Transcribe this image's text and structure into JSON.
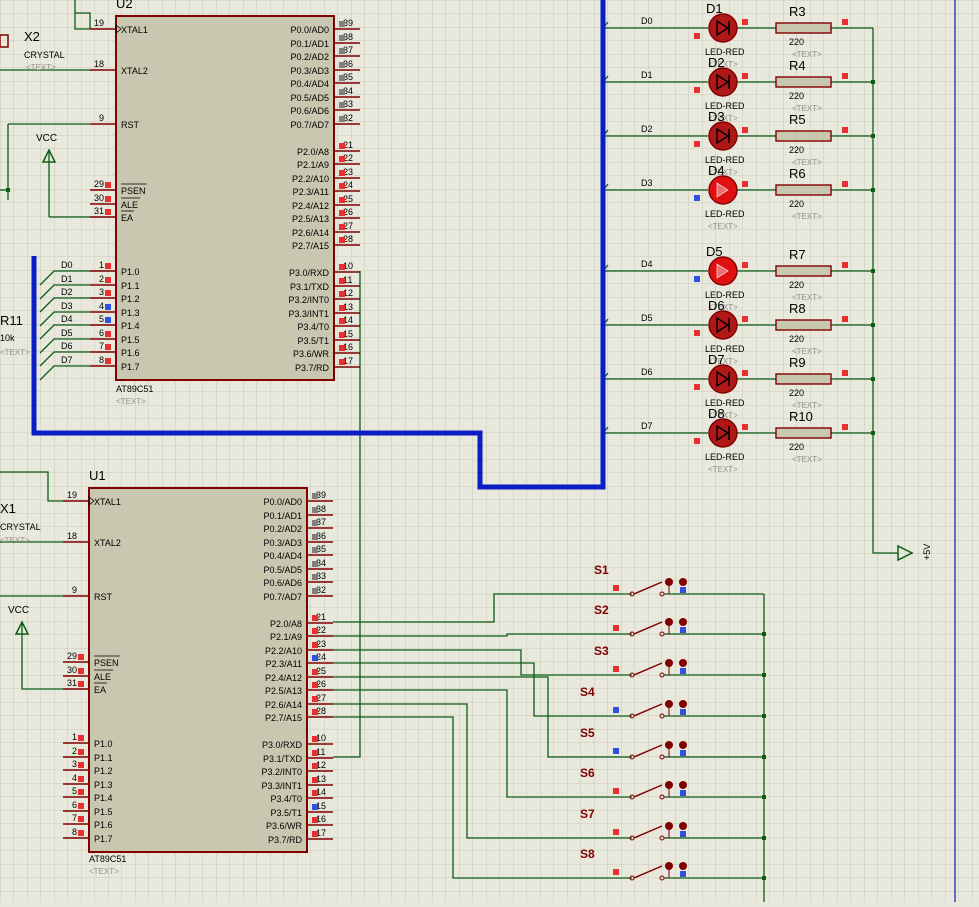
{
  "u2": {
    "ref": "U2",
    "part": "AT89C51",
    "text_tag": "<TEXT>",
    "left_pins": [
      {
        "num": "19",
        "name": "XTAL1"
      },
      {
        "num": "18",
        "name": "XTAL2"
      },
      {
        "num": "9",
        "name": "RST"
      },
      {
        "num": "29",
        "name": "PSEN"
      },
      {
        "num": "30",
        "name": "ALE"
      },
      {
        "num": "31",
        "name": "EA"
      },
      {
        "num": "1",
        "name": "P1.0"
      },
      {
        "num": "2",
        "name": "P1.1"
      },
      {
        "num": "3",
        "name": "P1.2"
      },
      {
        "num": "4",
        "name": "P1.3"
      },
      {
        "num": "5",
        "name": "P1.4"
      },
      {
        "num": "6",
        "name": "P1.5"
      },
      {
        "num": "7",
        "name": "P1.6"
      },
      {
        "num": "8",
        "name": "P1.7"
      }
    ],
    "right_pins": [
      {
        "num": "39",
        "name": "P0.0/AD0"
      },
      {
        "num": "38",
        "name": "P0.1/AD1"
      },
      {
        "num": "37",
        "name": "P0.2/AD2"
      },
      {
        "num": "36",
        "name": "P0.3/AD3"
      },
      {
        "num": "35",
        "name": "P0.4/AD4"
      },
      {
        "num": "34",
        "name": "P0.5/AD5"
      },
      {
        "num": "33",
        "name": "P0.6/AD6"
      },
      {
        "num": "32",
        "name": "P0.7/AD7"
      },
      {
        "num": "21",
        "name": "P2.0/A8"
      },
      {
        "num": "22",
        "name": "P2.1/A9"
      },
      {
        "num": "23",
        "name": "P2.2/A10"
      },
      {
        "num": "24",
        "name": "P2.3/A11"
      },
      {
        "num": "25",
        "name": "P2.4/A12"
      },
      {
        "num": "26",
        "name": "P2.5/A13"
      },
      {
        "num": "27",
        "name": "P2.6/A14"
      },
      {
        "num": "28",
        "name": "P2.7/A15"
      },
      {
        "num": "10",
        "name": "P3.0/RXD"
      },
      {
        "num": "11",
        "name": "P3.1/TXD"
      },
      {
        "num": "12",
        "name": "P3.2/INT0"
      },
      {
        "num": "13",
        "name": "P3.3/INT1"
      },
      {
        "num": "14",
        "name": "P3.4/T0"
      },
      {
        "num": "15",
        "name": "P3.5/T1"
      },
      {
        "num": "16",
        "name": "P3.6/WR"
      },
      {
        "num": "17",
        "name": "P3.7/RD"
      }
    ]
  },
  "u1": {
    "ref": "U1",
    "part": "AT89C51",
    "text_tag": "<TEXT>"
  },
  "crystal_top": {
    "ref": "X2",
    "value": "CRYSTAL",
    "text_tag": "<TEXT>"
  },
  "crystal_bottom": {
    "ref": "X1",
    "value": "CRYSTAL",
    "text_tag": "<TEXT>"
  },
  "resistor_left": {
    "ref": "R11",
    "value": "10k",
    "text_tag": "<TEXT>"
  },
  "vcc_label": "VCC",
  "supply_label": "+5V",
  "bus_labels": [
    "D0",
    "D1",
    "D2",
    "D3",
    "D4",
    "D5",
    "D6",
    "D7"
  ],
  "leds": [
    {
      "ref": "D1",
      "value": "LED-RED",
      "text_tag": "<TEXT>",
      "net": "D0",
      "lit": false
    },
    {
      "ref": "D2",
      "value": "LED-RED",
      "text_tag": "<TEXT>",
      "net": "D1",
      "lit": false
    },
    {
      "ref": "D3",
      "value": "LED-RED",
      "text_tag": "<TEXT>",
      "net": "D2",
      "lit": false
    },
    {
      "ref": "D4",
      "value": "LED-RED",
      "text_tag": "<TEXT>",
      "net": "D3",
      "lit": true
    },
    {
      "ref": "D5",
      "value": "LED-RED",
      "text_tag": "<TEXT>",
      "net": "D4",
      "lit": true
    },
    {
      "ref": "D6",
      "value": "LED-RED",
      "text_tag": "<TEXT>",
      "net": "D5",
      "lit": false
    },
    {
      "ref": "D7",
      "value": "LED-RED",
      "text_tag": "<TEXT>",
      "net": "D6",
      "lit": false
    },
    {
      "ref": "D8",
      "value": "LED-RED",
      "text_tag": "<TEXT>",
      "net": "D7",
      "lit": false
    }
  ],
  "resistors": [
    {
      "ref": "R3",
      "value": "220",
      "text_tag": "<TEXT>"
    },
    {
      "ref": "R4",
      "value": "220",
      "text_tag": "<TEXT>"
    },
    {
      "ref": "R5",
      "value": "220",
      "text_tag": "<TEXT>"
    },
    {
      "ref": "R6",
      "value": "220",
      "text_tag": "<TEXT>"
    },
    {
      "ref": "R7",
      "value": "220",
      "text_tag": "<TEXT>"
    },
    {
      "ref": "R8",
      "value": "220",
      "text_tag": "<TEXT>"
    },
    {
      "ref": "R9",
      "value": "220",
      "text_tag": "<TEXT>"
    },
    {
      "ref": "R10",
      "value": "220",
      "text_tag": "<TEXT>"
    }
  ],
  "switches": [
    "S1",
    "S2",
    "S3",
    "S4",
    "S5",
    "S6",
    "S7",
    "S8"
  ],
  "colors": {
    "background": "#e8e8dc",
    "grid": "#c9c9bd",
    "wire": "#0b5d14",
    "bus": "#0a1ec8",
    "component": "#800000",
    "ic_fill": "#c8c8b0",
    "pin_red": "#e83030",
    "pin_blue": "#3050e0",
    "pin_gray": "#808080",
    "led_off": "#b01818",
    "led_on": "#e01010",
    "text_gray": "#909090"
  }
}
